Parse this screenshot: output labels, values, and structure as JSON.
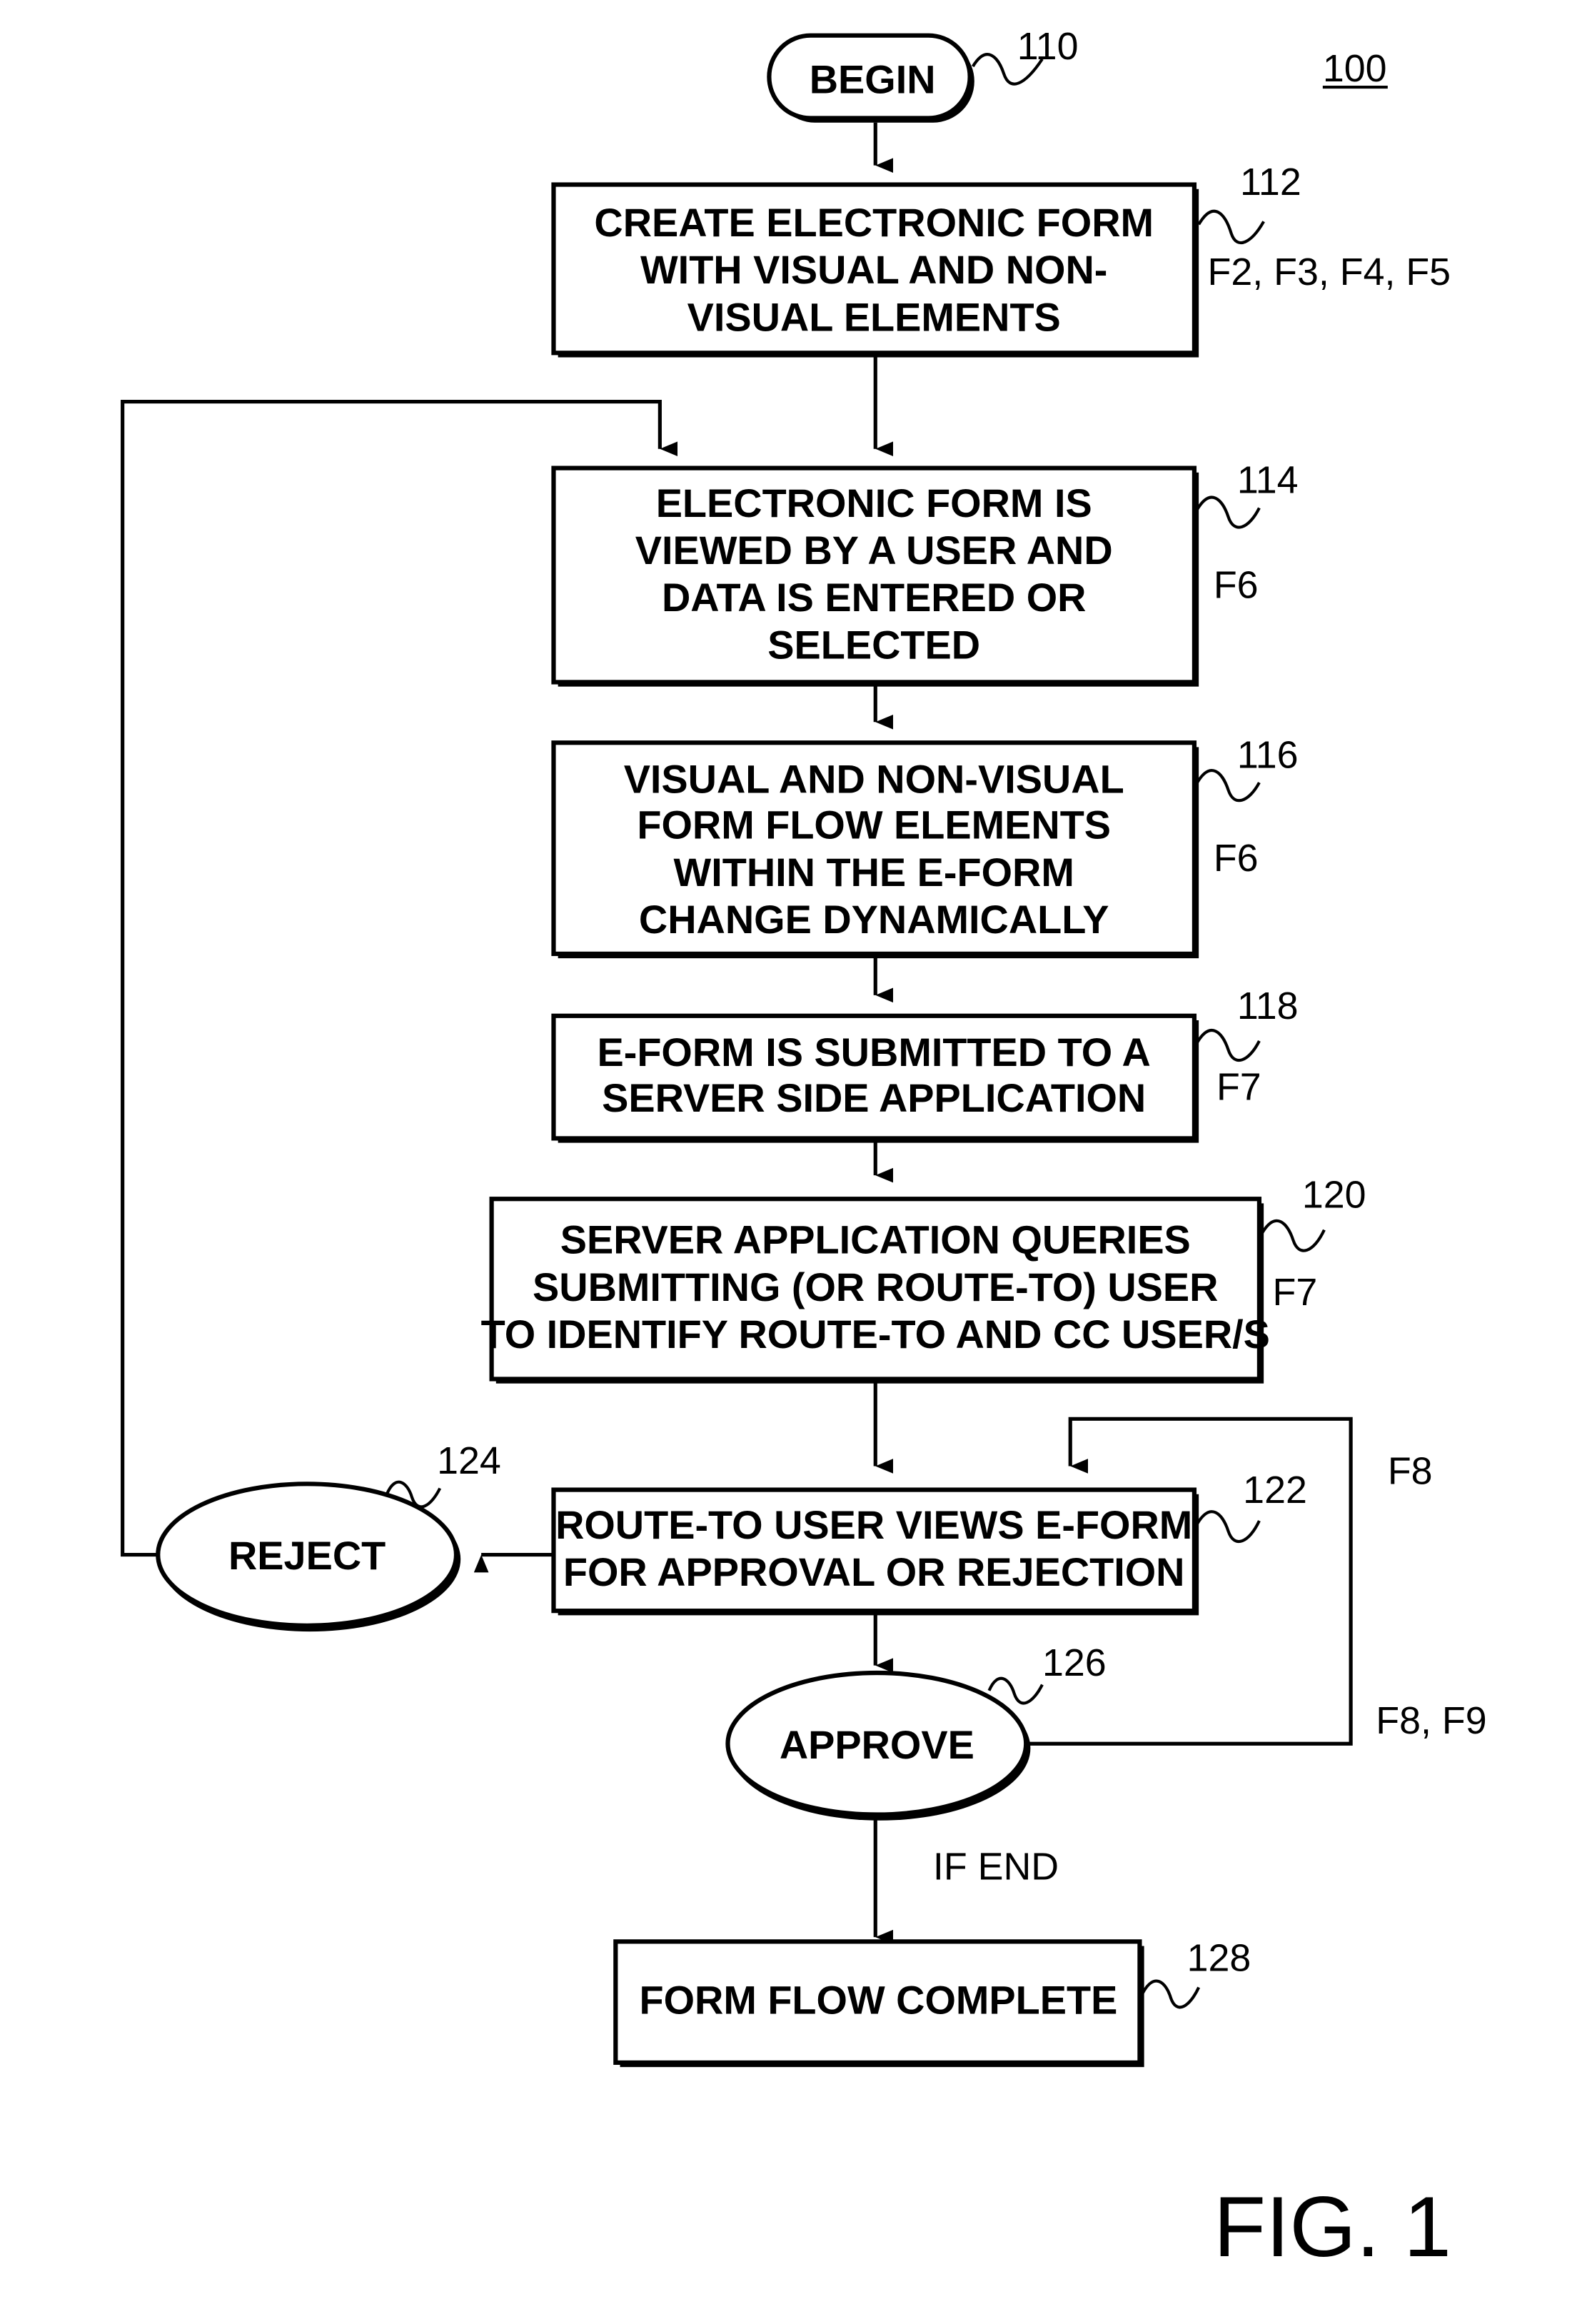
{
  "figure": {
    "diagram_number": "100",
    "caption": "FIG. 1"
  },
  "nodes": {
    "begin": {
      "ref": "110",
      "label": "BEGIN"
    },
    "create": {
      "ref": "112",
      "lines": [
        "CREATE ELECTRONIC FORM",
        "WITH VISUAL AND NON-",
        "VISUAL ELEMENTS"
      ],
      "figs": "F2, F3, F4, F5"
    },
    "view": {
      "ref": "114",
      "lines": [
        "ELECTRONIC FORM IS",
        "VIEWED BY A USER AND",
        "DATA IS ENTERED OR",
        "SELECTED"
      ],
      "figs": "F6"
    },
    "dynamic": {
      "ref": "116",
      "lines": [
        "VISUAL AND NON-VISUAL",
        "FORM FLOW ELEMENTS",
        "WITHIN THE E-FORM",
        "CHANGE DYNAMICALLY"
      ],
      "figs": "F6"
    },
    "submit": {
      "ref": "118",
      "lines": [
        "E-FORM IS SUBMITTED TO A",
        "SERVER SIDE APPLICATION"
      ],
      "figs": "F7"
    },
    "query": {
      "ref": "120",
      "lines": [
        "SERVER APPLICATION QUERIES",
        "SUBMITTING (OR ROUTE-TO) USER",
        "TO IDENTIFY ROUTE-TO AND CC USER/S"
      ],
      "figs": "F7"
    },
    "route": {
      "ref": "122",
      "lines": [
        "ROUTE-TO USER VIEWS E-FORM",
        "FOR APPROVAL OR REJECTION"
      ],
      "figs": "F8"
    },
    "reject": {
      "ref": "124",
      "label": "REJECT"
    },
    "approve": {
      "ref": "126",
      "label": "APPROVE",
      "figs": "F8, F9"
    },
    "complete": {
      "ref": "128",
      "label": "FORM FLOW COMPLETE"
    }
  },
  "edges": {
    "approve_to_complete": "IF END"
  }
}
